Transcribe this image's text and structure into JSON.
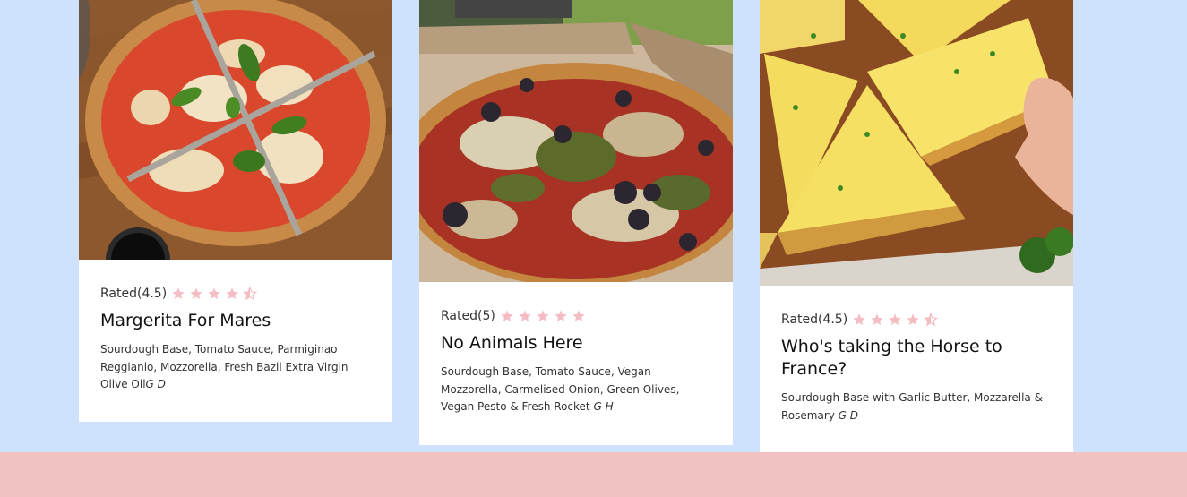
{
  "colors": {
    "page_bg": "#cfe2fd",
    "footer_bg": "#f2c2c3",
    "card_bg": "#ffffff",
    "star": "#f4bcc3"
  },
  "cards": [
    {
      "rating_label": "Rated(4.5)",
      "rating": 4.5,
      "title": "Margerita For Mares",
      "description": "Sourdough Base, Tomato Sauce, Parmiginao Reggianio, Mozzorella, Fresh Bazil Extra Virgin Olive Oil",
      "tags": "G D",
      "image": "margherita-pizza-photo"
    },
    {
      "rating_label": "Rated(5)",
      "rating": 5,
      "title": "No Animals Here",
      "description": "Sourdough Base, Tomato Sauce, Vegan Mozzorella, Carmelised Onion, Green Olives, Vegan Pesto & Fresh Rocket ",
      "tags": "G H",
      "image": "vegan-pizza-box-photo"
    },
    {
      "rating_label": "Rated(4.5)",
      "rating": 4.5,
      "title": "Who's taking the Horse to France?",
      "description": "Sourdough Base with Garlic Butter, Mozzarella & Rosemary ",
      "tags": "G D",
      "image": "garlic-cheese-pizza-photo"
    }
  ]
}
